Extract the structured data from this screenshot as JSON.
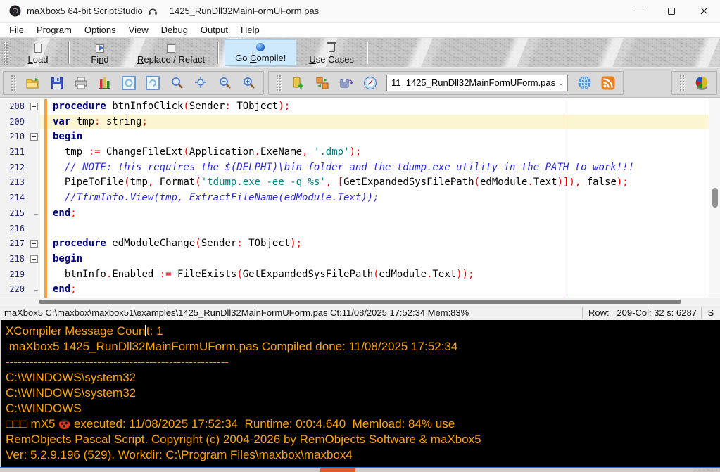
{
  "window": {
    "title_app": "maXbox5 64-bit ScriptStudio",
    "title_file": "1425_RunDll32MainFormUForm.pas"
  },
  "menu": {
    "items": [
      {
        "label": "File",
        "u": 0
      },
      {
        "label": "Program",
        "u": 0
      },
      {
        "label": "Options",
        "u": 0
      },
      {
        "label": "View",
        "u": 0
      },
      {
        "label": "Debug",
        "u": 0
      },
      {
        "label": "Output",
        "u": 5
      },
      {
        "label": "Help",
        "u": 0
      }
    ]
  },
  "toolbar": {
    "buttons": [
      {
        "label": "Load",
        "u": 0,
        "icon": "load-page-icon",
        "cls": "ic-page",
        "sep_after": true,
        "active": false
      },
      {
        "label": "Find",
        "u": 2,
        "icon": "find-icon",
        "cls": "ic-find",
        "sep_after": false,
        "active": false
      },
      {
        "label": "Replace / Refact",
        "u": 0,
        "icon": "replace-icon",
        "cls": "ic-replace",
        "sep_after": true,
        "active": false
      },
      {
        "label": "Go Compile!",
        "u": 3,
        "icon": "compile-sphere-icon",
        "cls": "ic-sphere",
        "sep_after": false,
        "active": true
      },
      {
        "label": "Use Cases",
        "u": 0,
        "icon": "use-cases-trash-icon",
        "cls": "ic-trash",
        "sep_after": true,
        "active": false
      }
    ]
  },
  "toolbar2": {
    "combo_value": "11  1425_RunDll32MainFormUForm.pas"
  },
  "editor": {
    "active_line": 209,
    "lines": [
      {
        "num": 208,
        "fold": "begin",
        "tokens": [
          [
            "kw",
            "procedure"
          ],
          [
            "id",
            " btnInfoClick"
          ],
          [
            "sym",
            "("
          ],
          [
            "id",
            "Sender"
          ],
          [
            "sym",
            ":"
          ],
          [
            "id",
            " TObject"
          ],
          [
            "sym",
            ");"
          ]
        ]
      },
      {
        "num": 209,
        "fold": "line",
        "tokens": [
          [
            "kw",
            "var"
          ],
          [
            "id",
            " tmp"
          ],
          [
            "sym",
            ":"
          ],
          [
            "id",
            " string"
          ],
          [
            "sym",
            ";"
          ]
        ]
      },
      {
        "num": 210,
        "fold": "begin-cont",
        "tokens": [
          [
            "kw",
            "begin"
          ]
        ]
      },
      {
        "num": 211,
        "fold": "line",
        "tokens": [
          [
            "id",
            "  tmp "
          ],
          [
            "sym",
            ":="
          ],
          [
            "id",
            " ChangeFileExt"
          ],
          [
            "sym",
            "("
          ],
          [
            "id",
            "Application"
          ],
          [
            "sym",
            "."
          ],
          [
            "id",
            "ExeName"
          ],
          [
            "sym",
            ","
          ],
          [
            "id",
            " "
          ],
          [
            "str",
            "'.dmp'"
          ],
          [
            "sym",
            ");"
          ]
        ]
      },
      {
        "num": 212,
        "fold": "line",
        "tokens": [
          [
            "cmt",
            "  // NOTE: this requires the $(DELPHI)\\bin folder and the tdump.exe utility in the PATH to work!!!"
          ]
        ]
      },
      {
        "num": 213,
        "fold": "line",
        "tokens": [
          [
            "id",
            "  PipeToFile"
          ],
          [
            "sym",
            "("
          ],
          [
            "id",
            "tmp"
          ],
          [
            "sym",
            ","
          ],
          [
            "id",
            " Format"
          ],
          [
            "sym",
            "("
          ],
          [
            "str",
            "'tdump.exe -ee -q %s'"
          ],
          [
            "sym",
            ","
          ],
          [
            "id",
            " "
          ],
          [
            "sym",
            "["
          ],
          [
            "id",
            "GetExpandedSysFilePath"
          ],
          [
            "sym",
            "("
          ],
          [
            "id",
            "edModule"
          ],
          [
            "sym",
            "."
          ],
          [
            "id",
            "Text"
          ],
          [
            "sym",
            ")]),"
          ],
          [
            "id",
            " false"
          ],
          [
            "sym",
            ");"
          ]
        ]
      },
      {
        "num": 214,
        "fold": "line",
        "tokens": [
          [
            "cmt",
            "  //TfrmInfo.View(tmp, ExtractFileName(edModule.Text));"
          ]
        ]
      },
      {
        "num": 215,
        "fold": "end",
        "tokens": [
          [
            "kw",
            "end"
          ],
          [
            "sym",
            ";"
          ]
        ]
      },
      {
        "num": 216,
        "fold": "none",
        "tokens": []
      },
      {
        "num": 217,
        "fold": "begin",
        "tokens": [
          [
            "kw",
            "procedure"
          ],
          [
            "id",
            " edModuleChange"
          ],
          [
            "sym",
            "("
          ],
          [
            "id",
            "Sender"
          ],
          [
            "sym",
            ":"
          ],
          [
            "id",
            " TObject"
          ],
          [
            "sym",
            ");"
          ]
        ]
      },
      {
        "num": 218,
        "fold": "begin-cont",
        "tokens": [
          [
            "kw",
            "begin"
          ]
        ]
      },
      {
        "num": 219,
        "fold": "line",
        "tokens": [
          [
            "id",
            "  btnInfo"
          ],
          [
            "sym",
            "."
          ],
          [
            "id",
            "Enabled "
          ],
          [
            "sym",
            ":="
          ],
          [
            "id",
            " FileExists"
          ],
          [
            "sym",
            "("
          ],
          [
            "id",
            "GetExpandedSysFilePath"
          ],
          [
            "sym",
            "("
          ],
          [
            "id",
            "edModule"
          ],
          [
            "sym",
            "."
          ],
          [
            "id",
            "Text"
          ],
          [
            "sym",
            "));"
          ]
        ]
      },
      {
        "num": 220,
        "fold": "end",
        "tokens": [
          [
            "kw",
            "end"
          ],
          [
            "sym",
            ";"
          ]
        ]
      }
    ]
  },
  "statusbar": {
    "left": "maXbox5 C:\\maxbox\\maxbox51\\examples\\1425_RunDll32MainFormUForm.pas Ct:11/08/2025 17:52:34 Mem:83%",
    "row_col": "Row:   209-Col: 32 s: 6287",
    "mode": "S"
  },
  "console": {
    "text_color": "#ffa300",
    "background": "#000000",
    "lines": [
      {
        "segments": [
          {
            "t": "XCompiler Message Coun"
          },
          {
            "caret": true
          },
          {
            "t": "t: 1"
          }
        ]
      },
      {
        "segments": [
          {
            "t": " maXbox5 1425_RunDll32MainFormUForm.pas Compiled done: 11/08/2025 17:52:34"
          }
        ]
      },
      {
        "segments": [
          {
            "t": "--------------------------------------------------------"
          }
        ]
      },
      {
        "segments": [
          {
            "t": "C:\\WINDOWS\\system32"
          }
        ]
      },
      {
        "segments": [
          {
            "t": "C:\\WINDOWS\\system32"
          }
        ]
      },
      {
        "segments": [
          {
            "t": "C:\\WINDOWS"
          }
        ]
      },
      {
        "segments": [
          {
            "t": "□□□ mX5 "
          },
          {
            "icon": "ladybug"
          },
          {
            "t": " executed: 11/08/2025 17:52:34  Runtime: 0:0:4.640  Memload: 84% use"
          }
        ]
      },
      {
        "segments": [
          {
            "t": "RemObjects Pascal Script. Copyright (c) 2004-2026 by RemObjects Software & maXbox5"
          }
        ]
      },
      {
        "segments": [
          {
            "t": "Ver: 5.2.9.196 (529). Workdir: C:\\Program Files\\maxbox\\maxbox4"
          }
        ]
      }
    ]
  },
  "colors": {
    "keyword": "#000080",
    "symbol": "#f00000",
    "string": "#008080",
    "comment": "#2a2ad0",
    "active_line_bg": "#fcf5d2",
    "change_bar": "#eca43e",
    "margin_line": "#c9a0cf",
    "compile_button_bg": "#cfe9fc"
  }
}
